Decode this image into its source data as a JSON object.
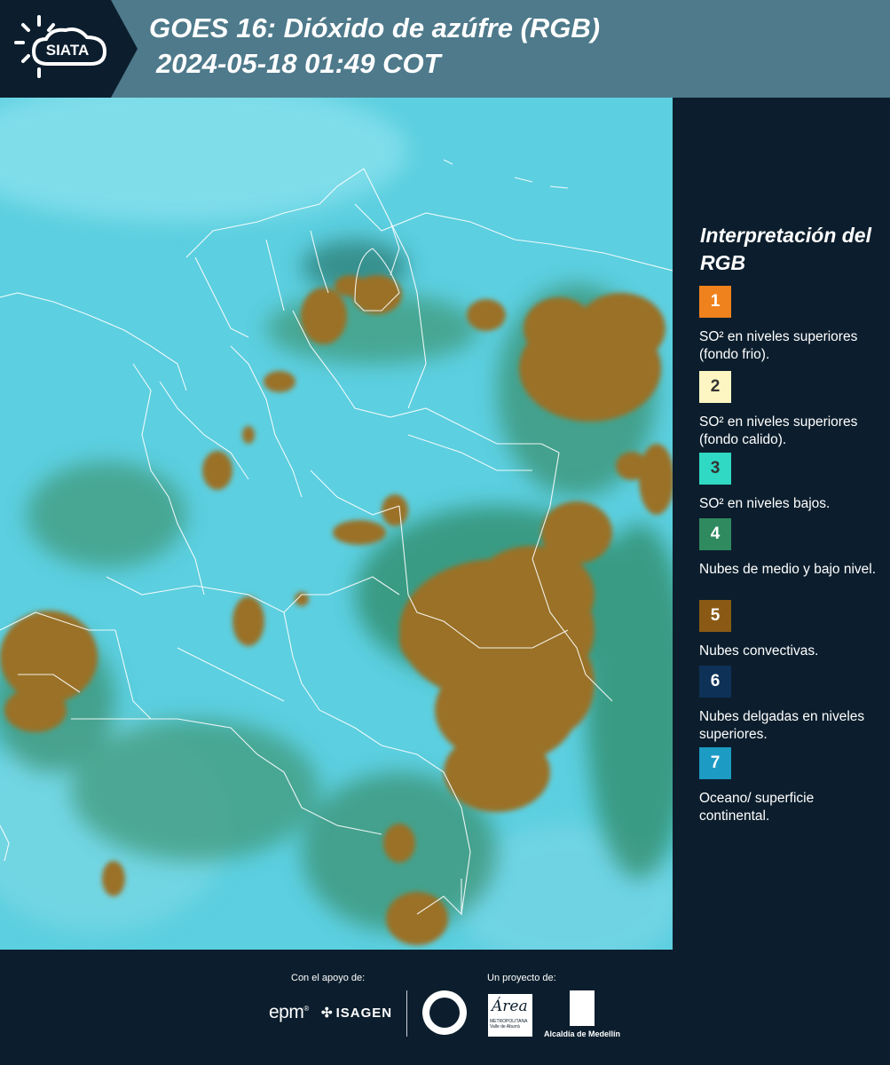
{
  "header": {
    "logo_text": "SIATA",
    "title_line1": "GOES 16: Dióxido de azúfre (RGB)",
    "title_line2": "2024-05-18 01:49 COT"
  },
  "legend": {
    "title": "Interpretación del RGB",
    "items": [
      {
        "number": "1",
        "label": "SO² en niveles superiores (fondo frio).",
        "color": "#f0821e",
        "text_color": "#ffffff"
      },
      {
        "number": "2",
        "label": "SO² en niveles superiores (fondo calido).",
        "color": "#fdf6c2",
        "text_color": "#333333"
      },
      {
        "number": "3",
        "label": "SO² en niveles bajos.",
        "color": "#2fd9c3",
        "text_color": "#333333"
      },
      {
        "number": "4",
        "label": "Nubes de medio y bajo nivel.",
        "color": "#2f8a5f",
        "text_color": "#ffffff"
      },
      {
        "number": "5",
        "label": "Nubes convectivas.",
        "color": "#8a5a15",
        "text_color": "#ffffff"
      },
      {
        "number": "6",
        "label": "Nubes delgadas en niveles superiores.",
        "color": "#0e3157",
        "text_color": "#ffffff"
      },
      {
        "number": "7",
        "label": "Oceano/ superficie continental.",
        "color": "#1c9bc4",
        "text_color": "#ffffff"
      }
    ]
  },
  "footer": {
    "support_label": "Con el apoyo de:",
    "project_label": "Un proyecto de:",
    "sponsor1": "epm",
    "sponsor2": "ISAGEN",
    "partner_area": "Área",
    "partner_area_sub": "METROPOLITANA Valle de Aburrá",
    "partner_alcaldia": "Alcaldía de Medellín"
  },
  "map": {
    "background_color": "#5ccfe0",
    "cloud_color": "#9a7126",
    "vegetation_color": "#3f9a7a"
  }
}
